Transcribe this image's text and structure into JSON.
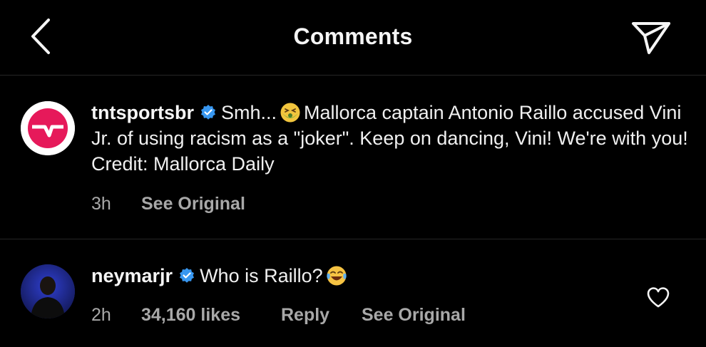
{
  "header": {
    "title": "Comments",
    "back_icon": "chevron-left-icon",
    "share_icon": "paper-plane-icon"
  },
  "post": {
    "username": "tntsportsbr",
    "caption_part1": "Smh...",
    "emoji1": "nauseated-face-emoji",
    "caption_part2": "Mallorca captain Antonio Raillo accused Vini Jr. of using racism as a \"joker\". Keep on dancing, Vini! We're with you! Credit: Mallorca Daily",
    "time": "3h",
    "see_original": "See Original"
  },
  "comment": {
    "username": "neymarjr",
    "text": "Who is Raillo?",
    "emoji": "tears-of-joy-emoji",
    "time": "2h",
    "likes": "34,160 likes",
    "reply": "Reply",
    "see_original": "See Original"
  },
  "colors": {
    "background": "#000000",
    "text": "#f5f5f5",
    "muted": "#a8a8a8",
    "divider": "#262626",
    "verified": "#3897f0",
    "tnt_brand": "#e6195a"
  }
}
